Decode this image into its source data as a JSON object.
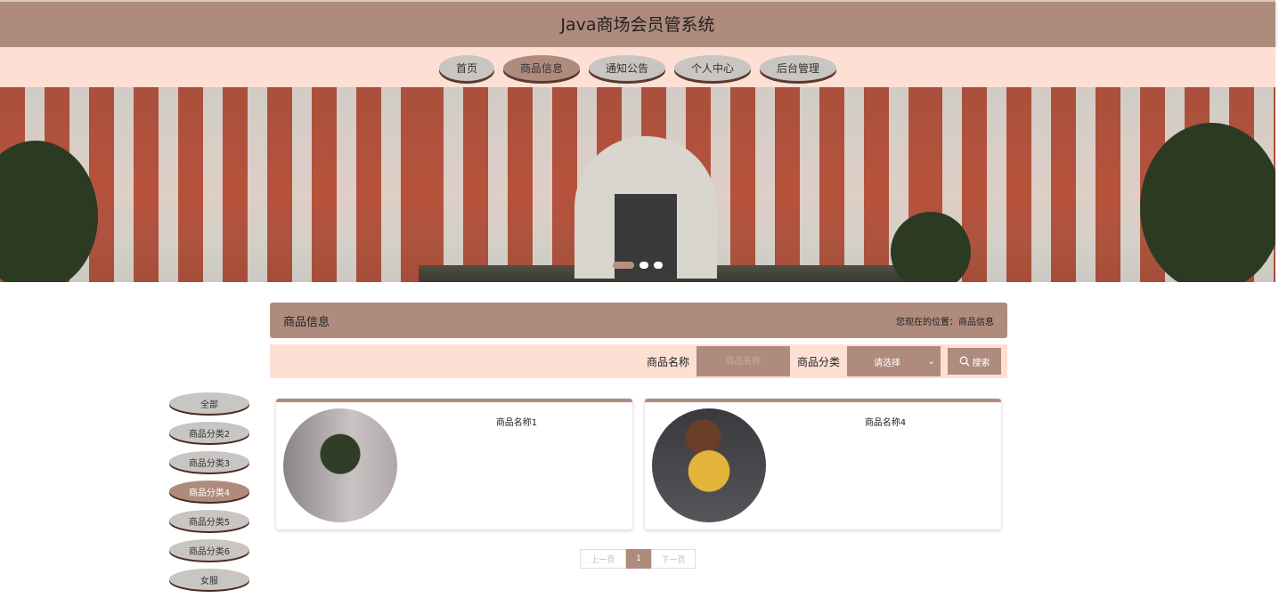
{
  "header": {
    "title": "Java商场会员管系统"
  },
  "nav": [
    {
      "label": "首页"
    },
    {
      "label": "商品信息",
      "active": true
    },
    {
      "label": "通知公告"
    },
    {
      "label": "个人中心"
    },
    {
      "label": "后台管理"
    }
  ],
  "banner": {
    "slides": 3,
    "active": 0
  },
  "section": {
    "title": "商品信息",
    "breadcrumb": "您现在的位置：商品信息"
  },
  "search": {
    "name_label": "商品名称",
    "name_placeholder": "商品名称",
    "category_label": "商品分类",
    "category_value": "请选择",
    "search_button": "搜索"
  },
  "sidebar": [
    {
      "label": "全部"
    },
    {
      "label": "商品分类2"
    },
    {
      "label": "商品分类3"
    },
    {
      "label": "商品分类4",
      "active": true
    },
    {
      "label": "商品分类5"
    },
    {
      "label": "商品分类6"
    },
    {
      "label": "女服"
    }
  ],
  "products": [
    {
      "name": "商品名称1"
    },
    {
      "name": "商品名称4"
    }
  ],
  "pagination": {
    "prev": "上一页",
    "current": "1",
    "next": "下一页"
  }
}
